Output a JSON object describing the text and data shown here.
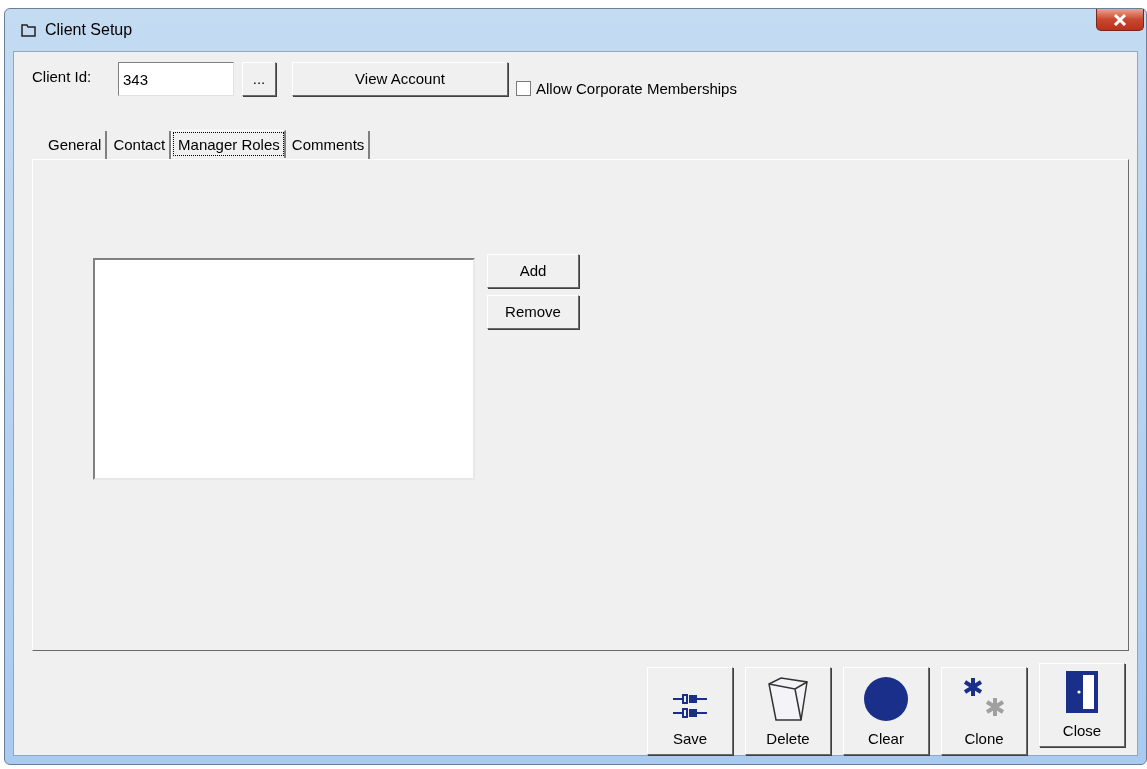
{
  "window": {
    "title": "Client Setup"
  },
  "client_id": {
    "label": "Client Id:",
    "value": "343"
  },
  "browse_button": "...",
  "view_account_button": "View Account",
  "allow_corporate": {
    "label": "Allow Corporate Memberships",
    "checked": false
  },
  "tabs": [
    {
      "label": "General",
      "selected": false
    },
    {
      "label": "Contact",
      "selected": false
    },
    {
      "label": "Manager Roles",
      "selected": true
    },
    {
      "label": "Comments",
      "selected": false
    }
  ],
  "role_buttons": [
    "Add",
    "Remove"
  ],
  "actions": [
    {
      "label": "Save",
      "kind": "save"
    },
    {
      "label": "Delete",
      "kind": "delete"
    },
    {
      "label": "Clear",
      "kind": "clear"
    },
    {
      "label": "Clone",
      "kind": "clone"
    },
    {
      "label": "Close",
      "kind": "close"
    }
  ]
}
